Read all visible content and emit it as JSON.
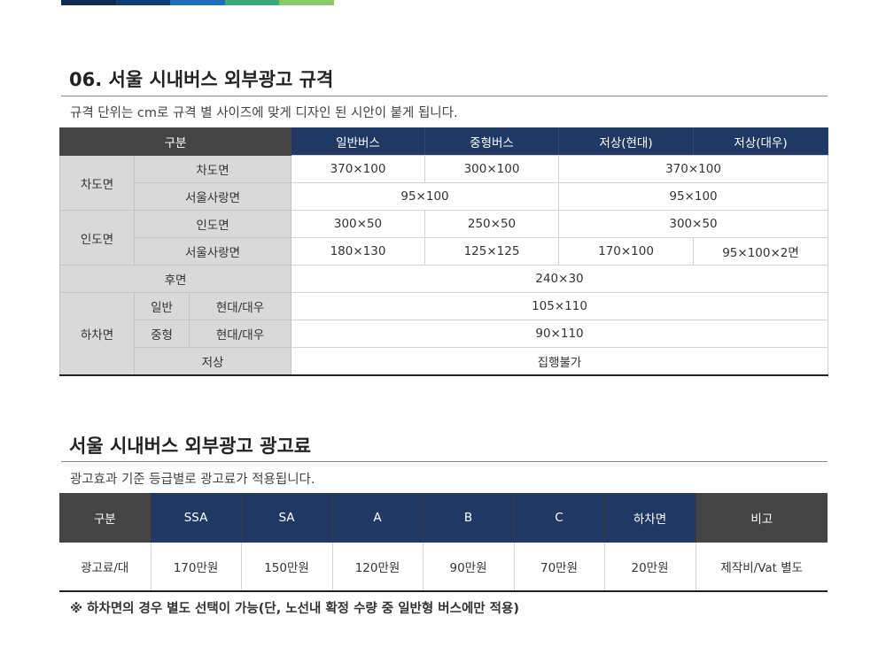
{
  "colors": {
    "top_bar": [
      "#0f2a4d",
      "#0f3c73",
      "#1e6fb8",
      "#3aaa7a",
      "#8bc96a"
    ],
    "header_dark": "#444444",
    "header_navy": "#1f3864",
    "label_gray": "#d9d9d9"
  },
  "spec": {
    "title": "06. 서울 시내버스 외부광고 규격",
    "description": "규격 단위는 cm로 규격 별 사이즈에 맞게 디자인 된 시안이 붙게 됩니다.",
    "header": {
      "category": "구분",
      "cols": [
        "일반버스",
        "중형버스",
        "저상(현대)",
        "저상(대우)"
      ]
    },
    "rows": {
      "roadside": {
        "group": "차도면",
        "sub1": "차도면",
        "sub1_v1": "370×100",
        "sub1_v2": "300×100",
        "sub1_v3": "370×100",
        "sub2": "서울사랑면",
        "sub2_v1": "95×100",
        "sub2_v2": "95×100"
      },
      "sidewalk": {
        "group": "인도면",
        "sub1": "인도면",
        "sub1_v1": "300×50",
        "sub1_v2": "250×50",
        "sub1_v3": "300×50",
        "sub2": "서울사랑면",
        "sub2_v1": "180×130",
        "sub2_v2": "125×125",
        "sub2_v3": "170×100",
        "sub2_v4": "95×100×2면"
      },
      "rear": {
        "label": "후면",
        "value": "240×30"
      },
      "exit": {
        "group": "하차면",
        "r1_type": "일반",
        "r1_maker": "현대/대우",
        "r1_value": "105×110",
        "r2_type": "중형",
        "r2_maker": "현대/대우",
        "r2_value": "90×110",
        "r3_type": "저상",
        "r3_value": "집행불가"
      }
    }
  },
  "fee": {
    "title": "서울 시내버스 외부광고 광고료",
    "description": "광고효과 기준 등급별로 광고료가 적용됩니다.",
    "header": [
      "구분",
      "SSA",
      "SA",
      "A",
      "B",
      "C",
      "하차면",
      "비고"
    ],
    "row": [
      "광고료/대",
      "170만원",
      "150만원",
      "120만원",
      "90만원",
      "70만원",
      "20만원",
      "제작비/Vat 별도"
    ]
  },
  "footnote": "※ 하차면의 경우 별도 선택이 가능(단, 노선내 확정 수량 중 일반형 버스에만 적용)"
}
